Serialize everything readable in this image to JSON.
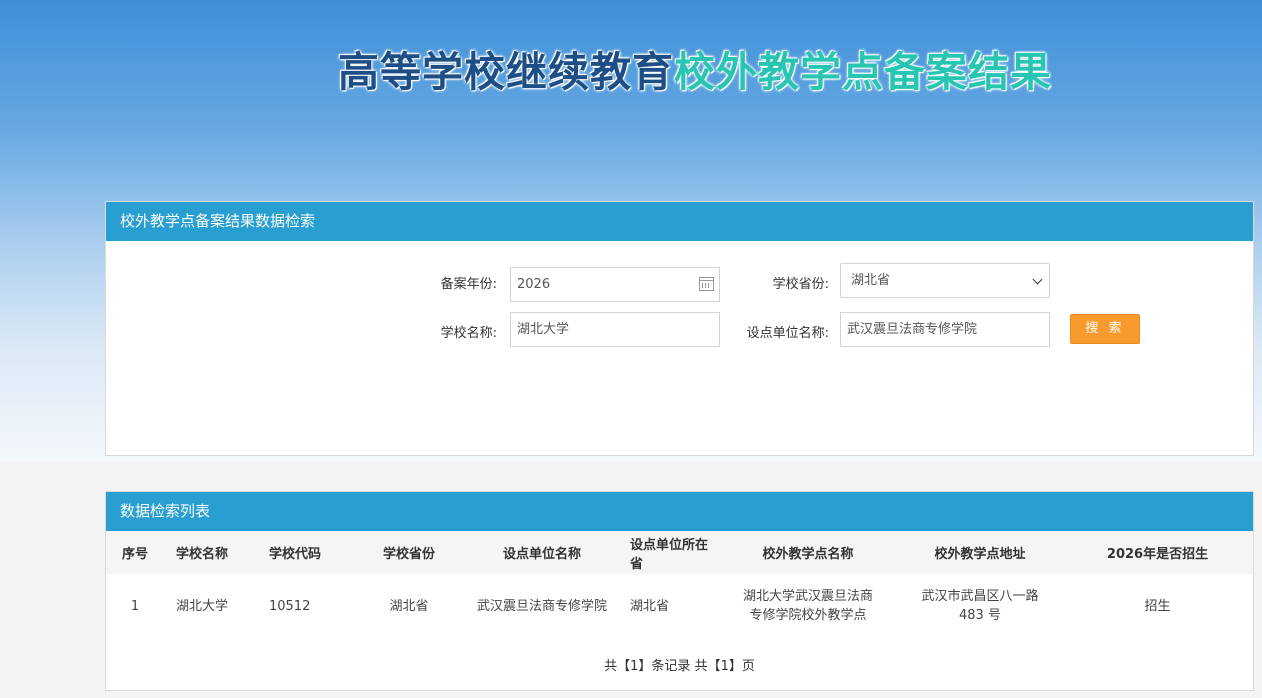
{
  "banner": {
    "title_part1": "高等学校继续教育",
    "title_part2": "校外教学点备案结果"
  },
  "search": {
    "header": "校外教学点备案结果数据检索",
    "year_label": "备案年份:",
    "year_value": "2026",
    "province_label": "学校省份:",
    "province_value": "湖北省",
    "school_label": "学校名称:",
    "school_value": "湖北大学",
    "unit_label": "设点单位名称:",
    "unit_value": "武汉震旦法商专修学院",
    "button_label": "搜 索"
  },
  "results": {
    "header": "数据检索列表",
    "columns": [
      "序号",
      "学校名称",
      "学校代码",
      "学校省份",
      "设点单位名称",
      "设点单位所在省",
      "校外教学点名称",
      "校外教学点地址",
      "2026年是否招生"
    ],
    "rows": [
      {
        "index": "1",
        "school": "湖北大学",
        "code": "10512",
        "province": "湖北省",
        "unit": "武汉震旦法商专修学院",
        "unit_province": "湖北省",
        "site_name_line1": "湖北大学武汉震旦法商",
        "site_name_line2": "专修学院校外教学点",
        "address_line1": "武汉市武昌区八一路",
        "address_line2": "483 号",
        "enroll": "招生"
      }
    ],
    "pager": {
      "prefix": "共【",
      "records": "1",
      "mid": "】条记录 共【",
      "pages": "1",
      "suffix": "】页"
    }
  },
  "colors": {
    "header_blue": "#289fd0",
    "button_orange": "#f89a2e",
    "title_dark": "#1d4f86",
    "title_teal": "#28c6b2"
  }
}
